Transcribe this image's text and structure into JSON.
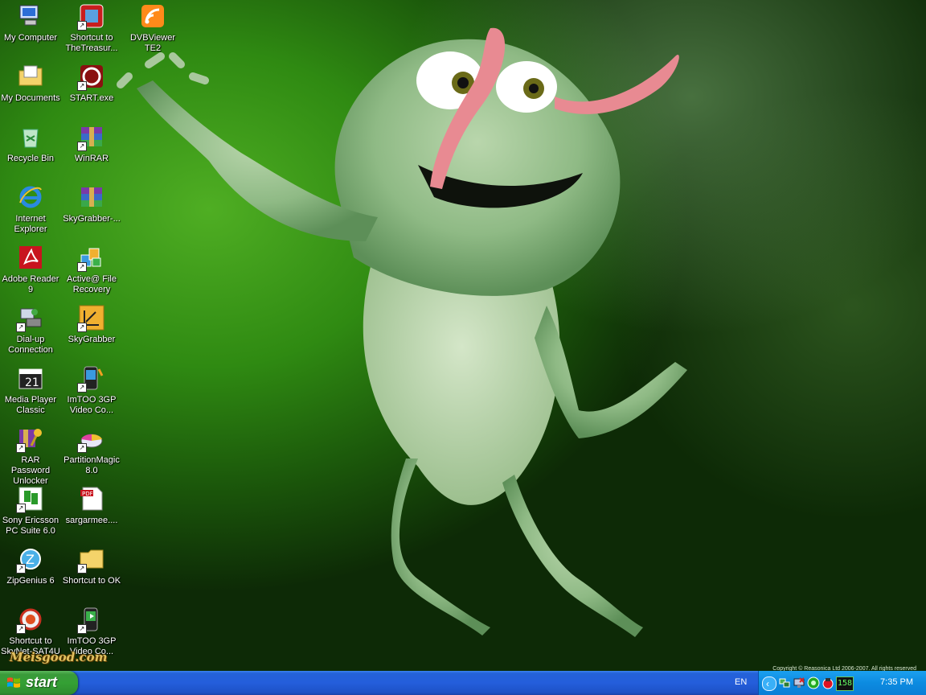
{
  "desktop": {
    "icons": [
      {
        "label": "My Computer",
        "icon": "my-computer-icon"
      },
      {
        "label": "Shortcut to TheTreasur...",
        "icon": "treasure-app-icon",
        "shortcut": true
      },
      {
        "label": "DVBViewer TE2",
        "icon": "dvbviewer-icon"
      },
      {
        "label": "My Documents",
        "icon": "my-documents-icon"
      },
      {
        "label": "START.exe",
        "icon": "start-exe-icon",
        "shortcut": true
      },
      {
        "label": "Recycle Bin",
        "icon": "recycle-bin-icon"
      },
      {
        "label": "WinRAR",
        "icon": "winrar-icon",
        "shortcut": true
      },
      {
        "label": "Internet Explorer",
        "icon": "internet-explorer-icon"
      },
      {
        "label": "SkyGrabber-...",
        "icon": "winrar-archive-icon"
      },
      {
        "label": "Adobe Reader 9",
        "icon": "adobe-reader-icon"
      },
      {
        "label": "Active@ File Recovery",
        "icon": "file-recovery-icon",
        "shortcut": true
      },
      {
        "label": "Dial-up Connection",
        "icon": "dialup-icon",
        "shortcut": true
      },
      {
        "label": "SkyGrabber",
        "icon": "skygrabber-icon",
        "shortcut": true
      },
      {
        "label": "Media Player Classic",
        "icon": "media-player-icon"
      },
      {
        "label": "ImTOO 3GP Video Co...",
        "icon": "imtoo-icon",
        "shortcut": true
      },
      {
        "label": "RAR Password Unlocker",
        "icon": "rar-unlocker-icon",
        "shortcut": true
      },
      {
        "label": "PartitionMagic 8.0",
        "icon": "partitionmagic-icon",
        "shortcut": true
      },
      {
        "label": "Sony Ericsson PC Suite 6.0",
        "icon": "sony-ericsson-icon",
        "shortcut": true
      },
      {
        "label": "sargarmee....",
        "icon": "pdf-file-icon"
      },
      {
        "label": "ZipGenius 6",
        "icon": "zipgenius-icon",
        "shortcut": true
      },
      {
        "label": "Shortcut to OK",
        "icon": "folder-icon",
        "shortcut": true
      },
      {
        "label": "Shortcut to SkyNet-SAT4U",
        "icon": "skynet-icon",
        "shortcut": true
      },
      {
        "label": "ImTOO 3GP Video Co...",
        "icon": "imtoo-icon-2",
        "shortcut": true
      }
    ],
    "watermark": "Meisgood.com",
    "wallpaper_copyright": "Copyright © Reasonica Ltd 2006-2007. All rights reserved"
  },
  "taskbar": {
    "start_label": "start",
    "language": "EN",
    "tray_icons": [
      "network-icon",
      "monitor-icon",
      "green-circle-icon",
      "red-app-icon",
      "counter-icon"
    ],
    "tray_counter": "158",
    "clock": "7:35 PM"
  }
}
